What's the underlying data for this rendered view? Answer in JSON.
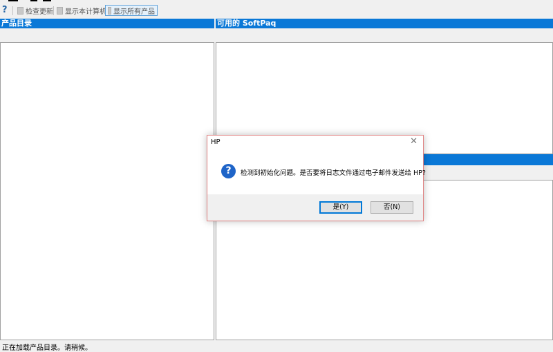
{
  "toolbar": {
    "check_updates": "检查更新",
    "show_this_computer": "显示本计算机",
    "show_all_products": "显示所有产品"
  },
  "left_pane": {
    "title": "产品目录"
  },
  "right_pane": {
    "title": "可用的 SoftPaq"
  },
  "status_bar": {
    "text": "正在加载产品目录。请稍候。"
  },
  "dialog": {
    "title": "HP",
    "message": "检测到初始化问题。是否要将日志文件通过电子邮件发送给 HP?",
    "yes_label": "是(Y)",
    "no_label": "否(N)",
    "icon": "question-icon"
  },
  "colors": {
    "header_blue": "#0a78d7",
    "dialog_border": "#e08080"
  }
}
